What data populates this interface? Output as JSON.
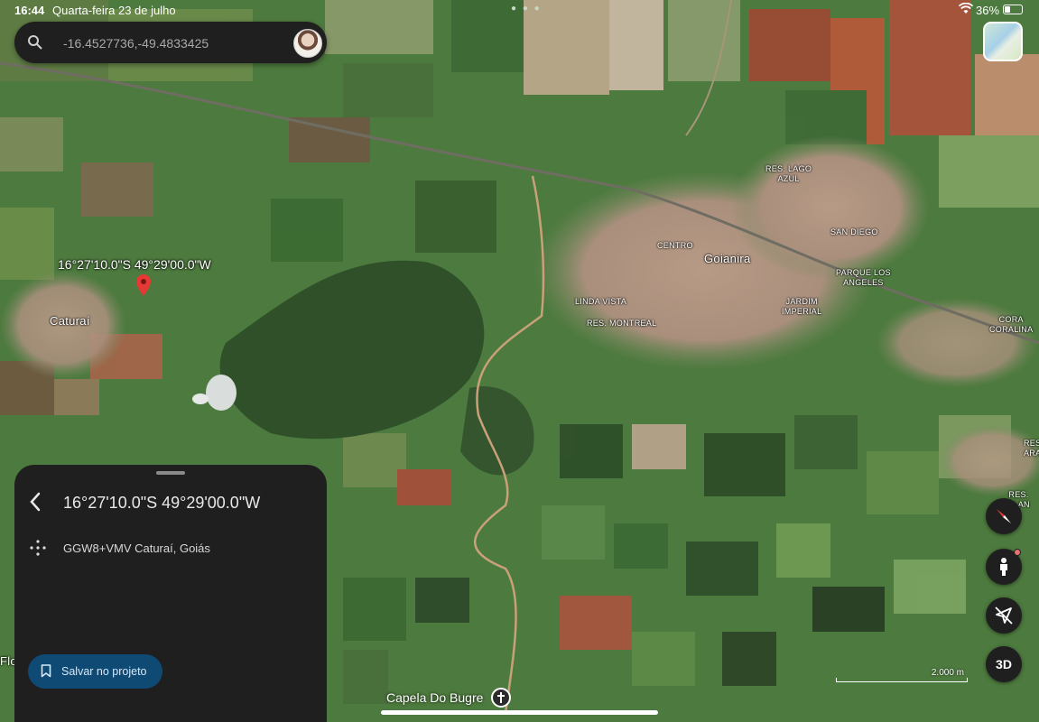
{
  "status_bar": {
    "time": "16:44",
    "date": "Quarta-feira 23 de julho",
    "battery": "36%"
  },
  "search": {
    "value": "-16.4527736,-49.4833425",
    "icon": "search-icon"
  },
  "map": {
    "pin_coordinates": "16°27'10.0\"S 49°29'00.0\"W",
    "place_labels": {
      "res_lago_azul": "RES. LAGO\nAZUL",
      "san_diego": "SAN DIEGO",
      "centro": "CENTRO",
      "goianira": "Goianira",
      "parque_los_angeles": "PARQUE LOS\nANGELES",
      "linda_vista": "LINDA VISTA",
      "jardim_imperial": "JARDIM\nIMPERIAL",
      "res_montreal": "RES. MONTREAL",
      "cora_coralina": "CORA\nCORALINA",
      "caturai": "Caturaí",
      "res_aragu": "RES\nARAGU",
      "res_plan": "RES. PLAN",
      "flo": "Flo",
      "capela_do_bugre": "Capela Do Bugre"
    },
    "scale": "2.000 m"
  },
  "place_panel": {
    "title": "16°27'10.0\"S 49°29'00.0\"W",
    "plus_code": "GGW8+VMV Caturaí, Goiás",
    "save_button": "Salvar no projeto"
  },
  "controls": {
    "view_3d": "3D"
  },
  "colors": {
    "panel_bg": "#1f1f1f",
    "save_button_bg": "#0e4a74",
    "pin": "#e53935"
  }
}
